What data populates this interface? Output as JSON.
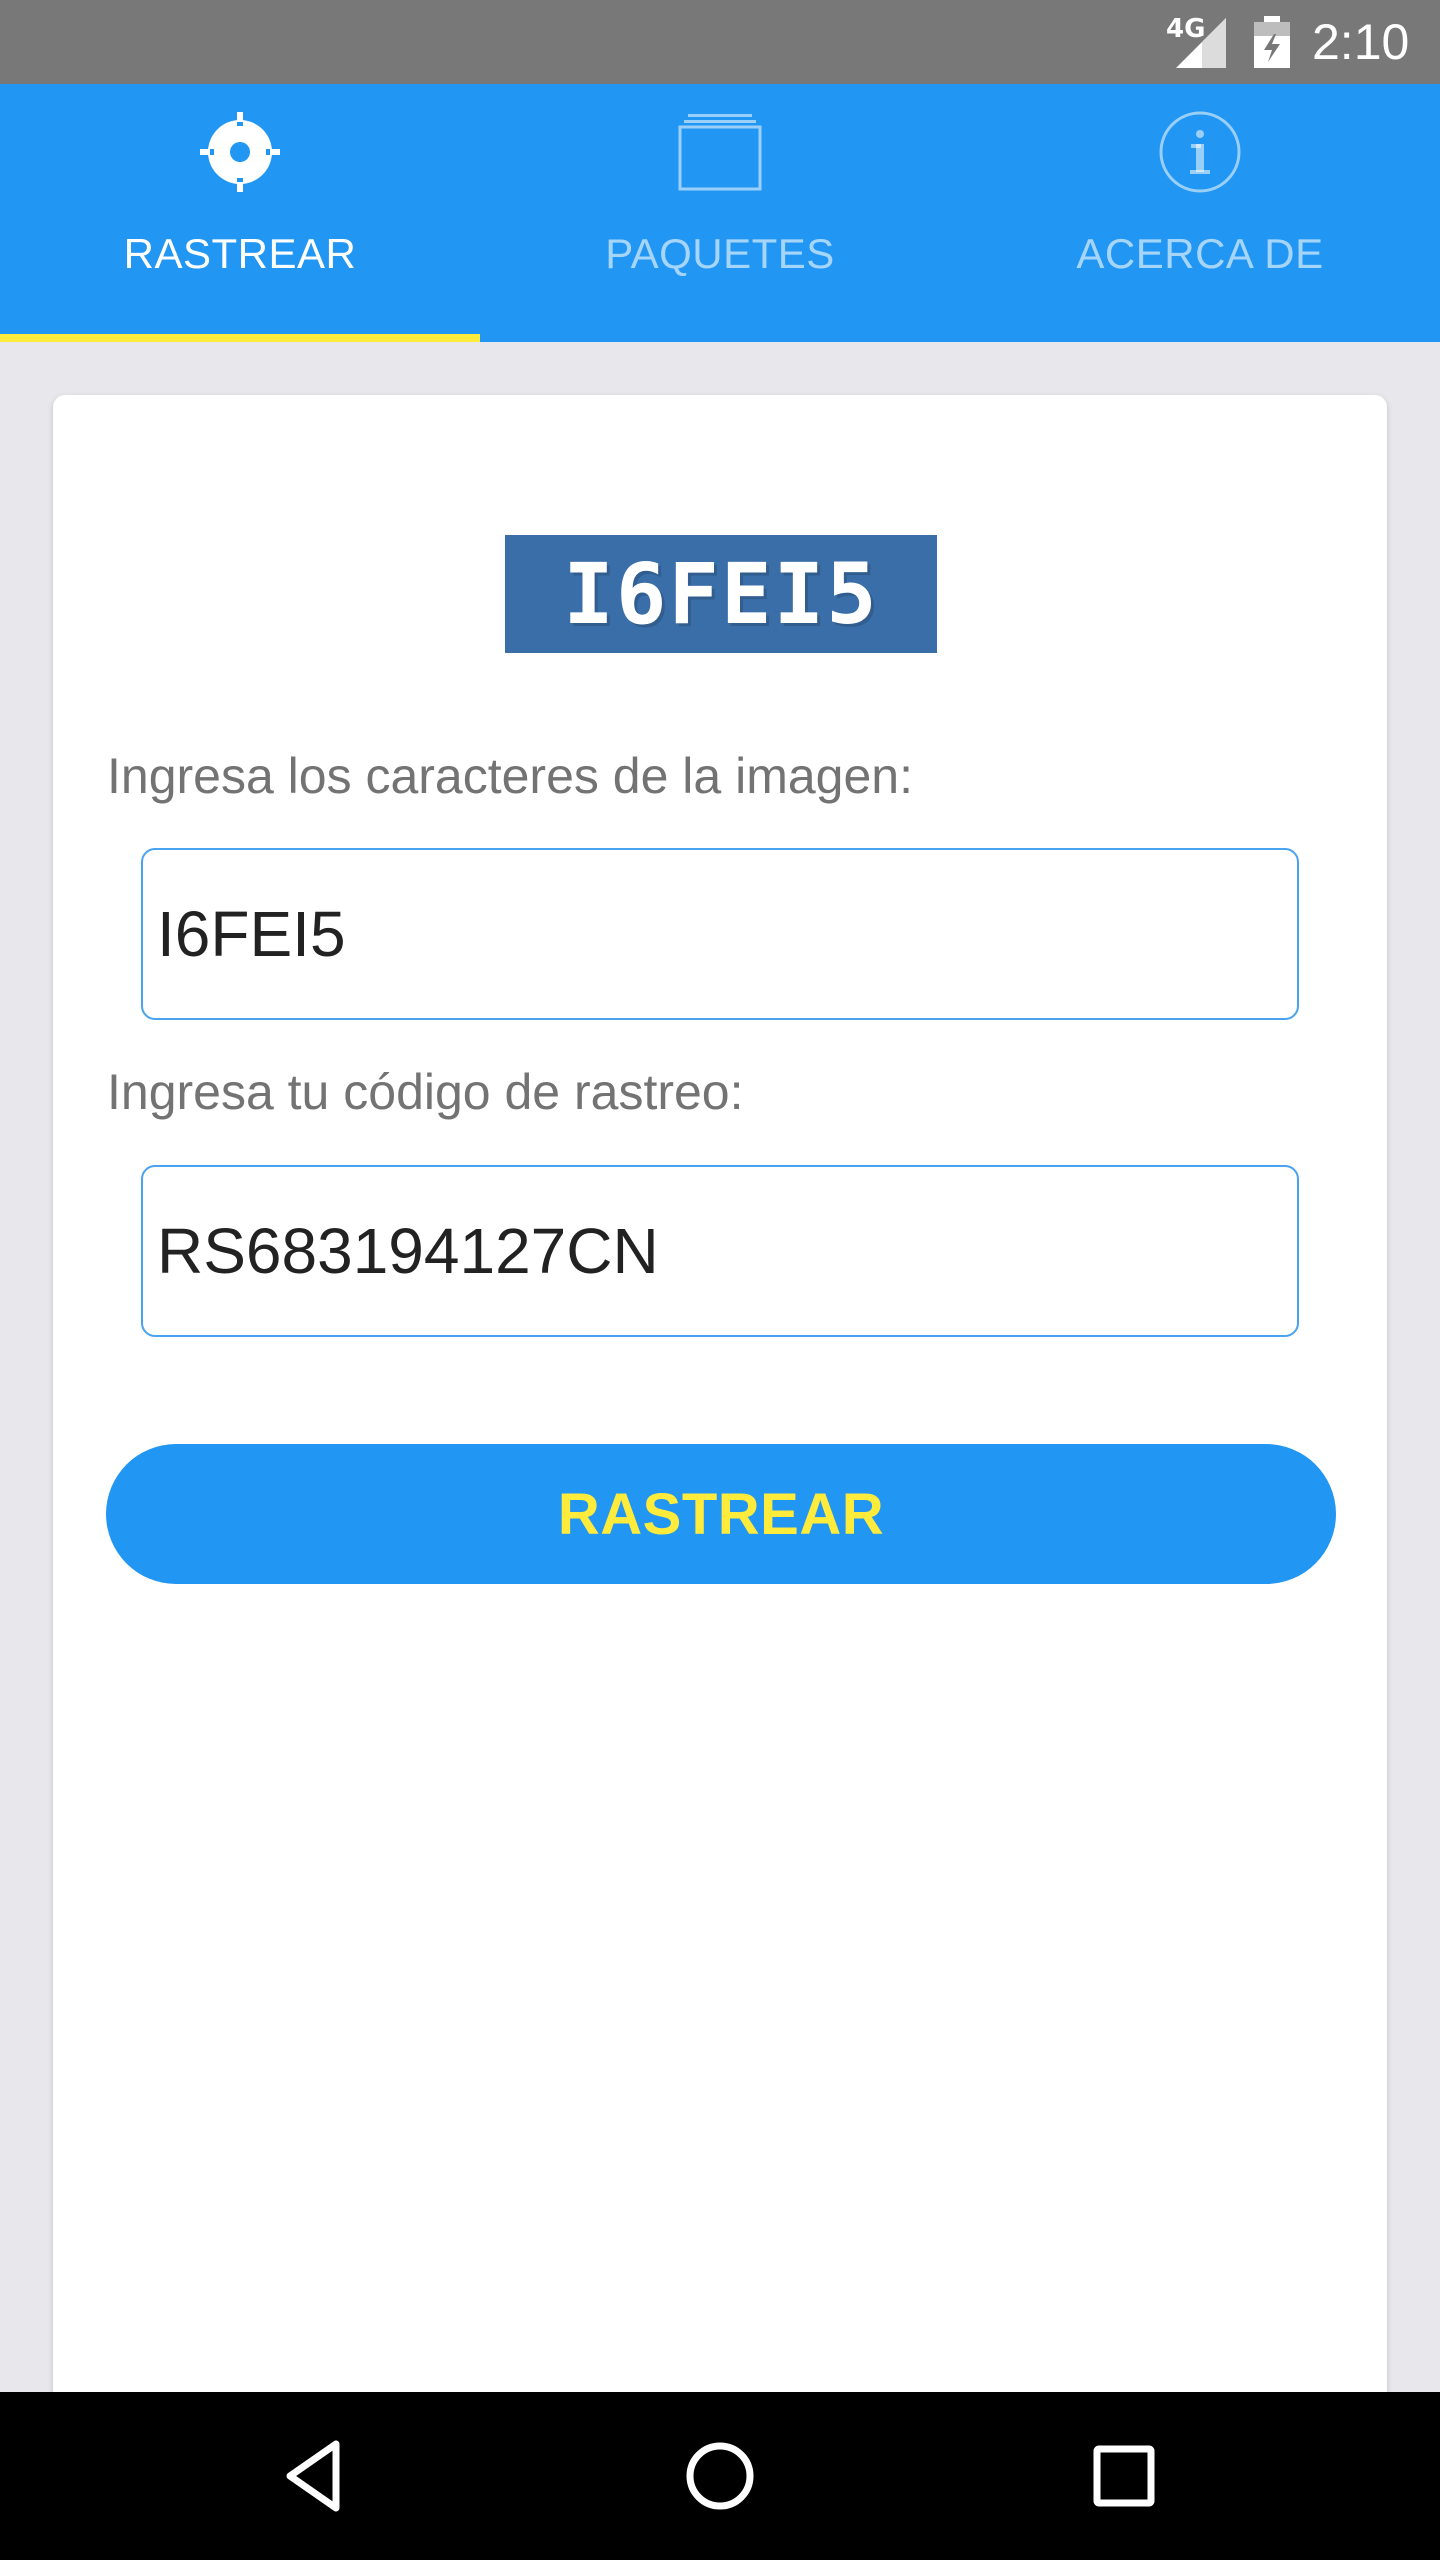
{
  "status_bar": {
    "network_label": "4G",
    "time": "2:10",
    "icons": [
      "signal-icon",
      "battery-icon"
    ]
  },
  "tabs": [
    {
      "label": "RASTREAR",
      "icon": "crosshair-icon",
      "active": true
    },
    {
      "label": "PAQUETES",
      "icon": "package-stack-icon",
      "active": false
    },
    {
      "label": "ACERCA DE",
      "icon": "info-icon",
      "active": false
    }
  ],
  "colors": {
    "primary": "#2196f3",
    "accent": "#ffeb3b",
    "status_bar": "#787878",
    "captcha_bg": "#3a6ea8"
  },
  "form": {
    "captcha_text": "I6FEI5",
    "captcha_label": "Ingresa los caracteres de la imagen:",
    "captcha_value": "I6FEI5",
    "tracking_label": "Ingresa tu código de rastreo:",
    "tracking_value": "RS683194127CN",
    "submit_label": "RASTREAR"
  },
  "nav_bar": {
    "buttons": [
      "back-icon",
      "home-icon",
      "recents-icon"
    ]
  }
}
